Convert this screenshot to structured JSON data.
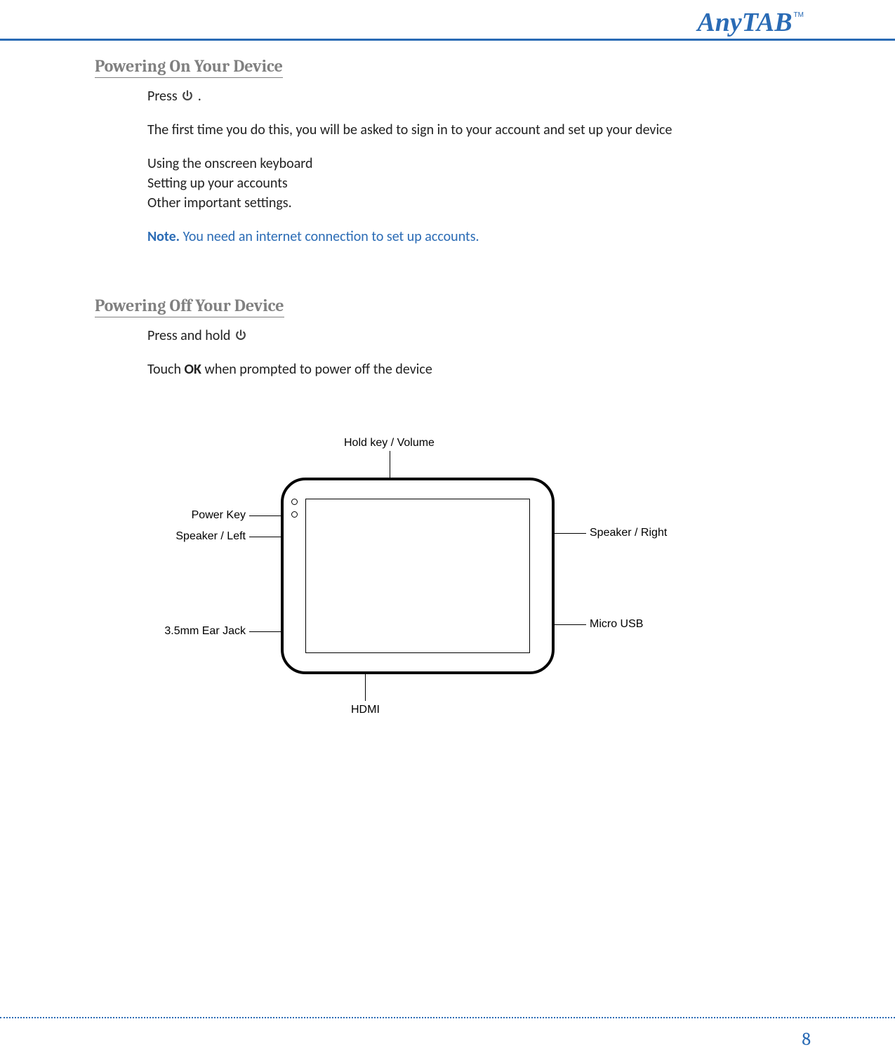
{
  "brand": {
    "name": "AnyTAB",
    "tm": "TM"
  },
  "page_number": "8",
  "section1": {
    "heading": "Powering On Your Device",
    "line1_pre": "Press ",
    "line1_post": ".",
    "line2": "The first time you do this, you will be asked to sign in to your account and set up your device",
    "bullet1": "Using the onscreen keyboard",
    "bullet2": "Setting up your accounts",
    "bullet3": "Other important settings.",
    "note_label": "Note.",
    "note_text": " You need an internet connection to set up accounts."
  },
  "section2": {
    "heading": "Powering Off Your Device",
    "line1_pre": "Press and hold ",
    "line2_pre": "Touch ",
    "line2_bold": "OK",
    "line2_post": " when prompted to power off the device"
  },
  "diagram": {
    "top": "Hold key / Volume",
    "left1": "Power Key",
    "left2": "Speaker / Left",
    "left3": "3.5mm Ear Jack",
    "right1": "Speaker / Right",
    "right2": "Micro USB",
    "bottom": "HDMI"
  }
}
